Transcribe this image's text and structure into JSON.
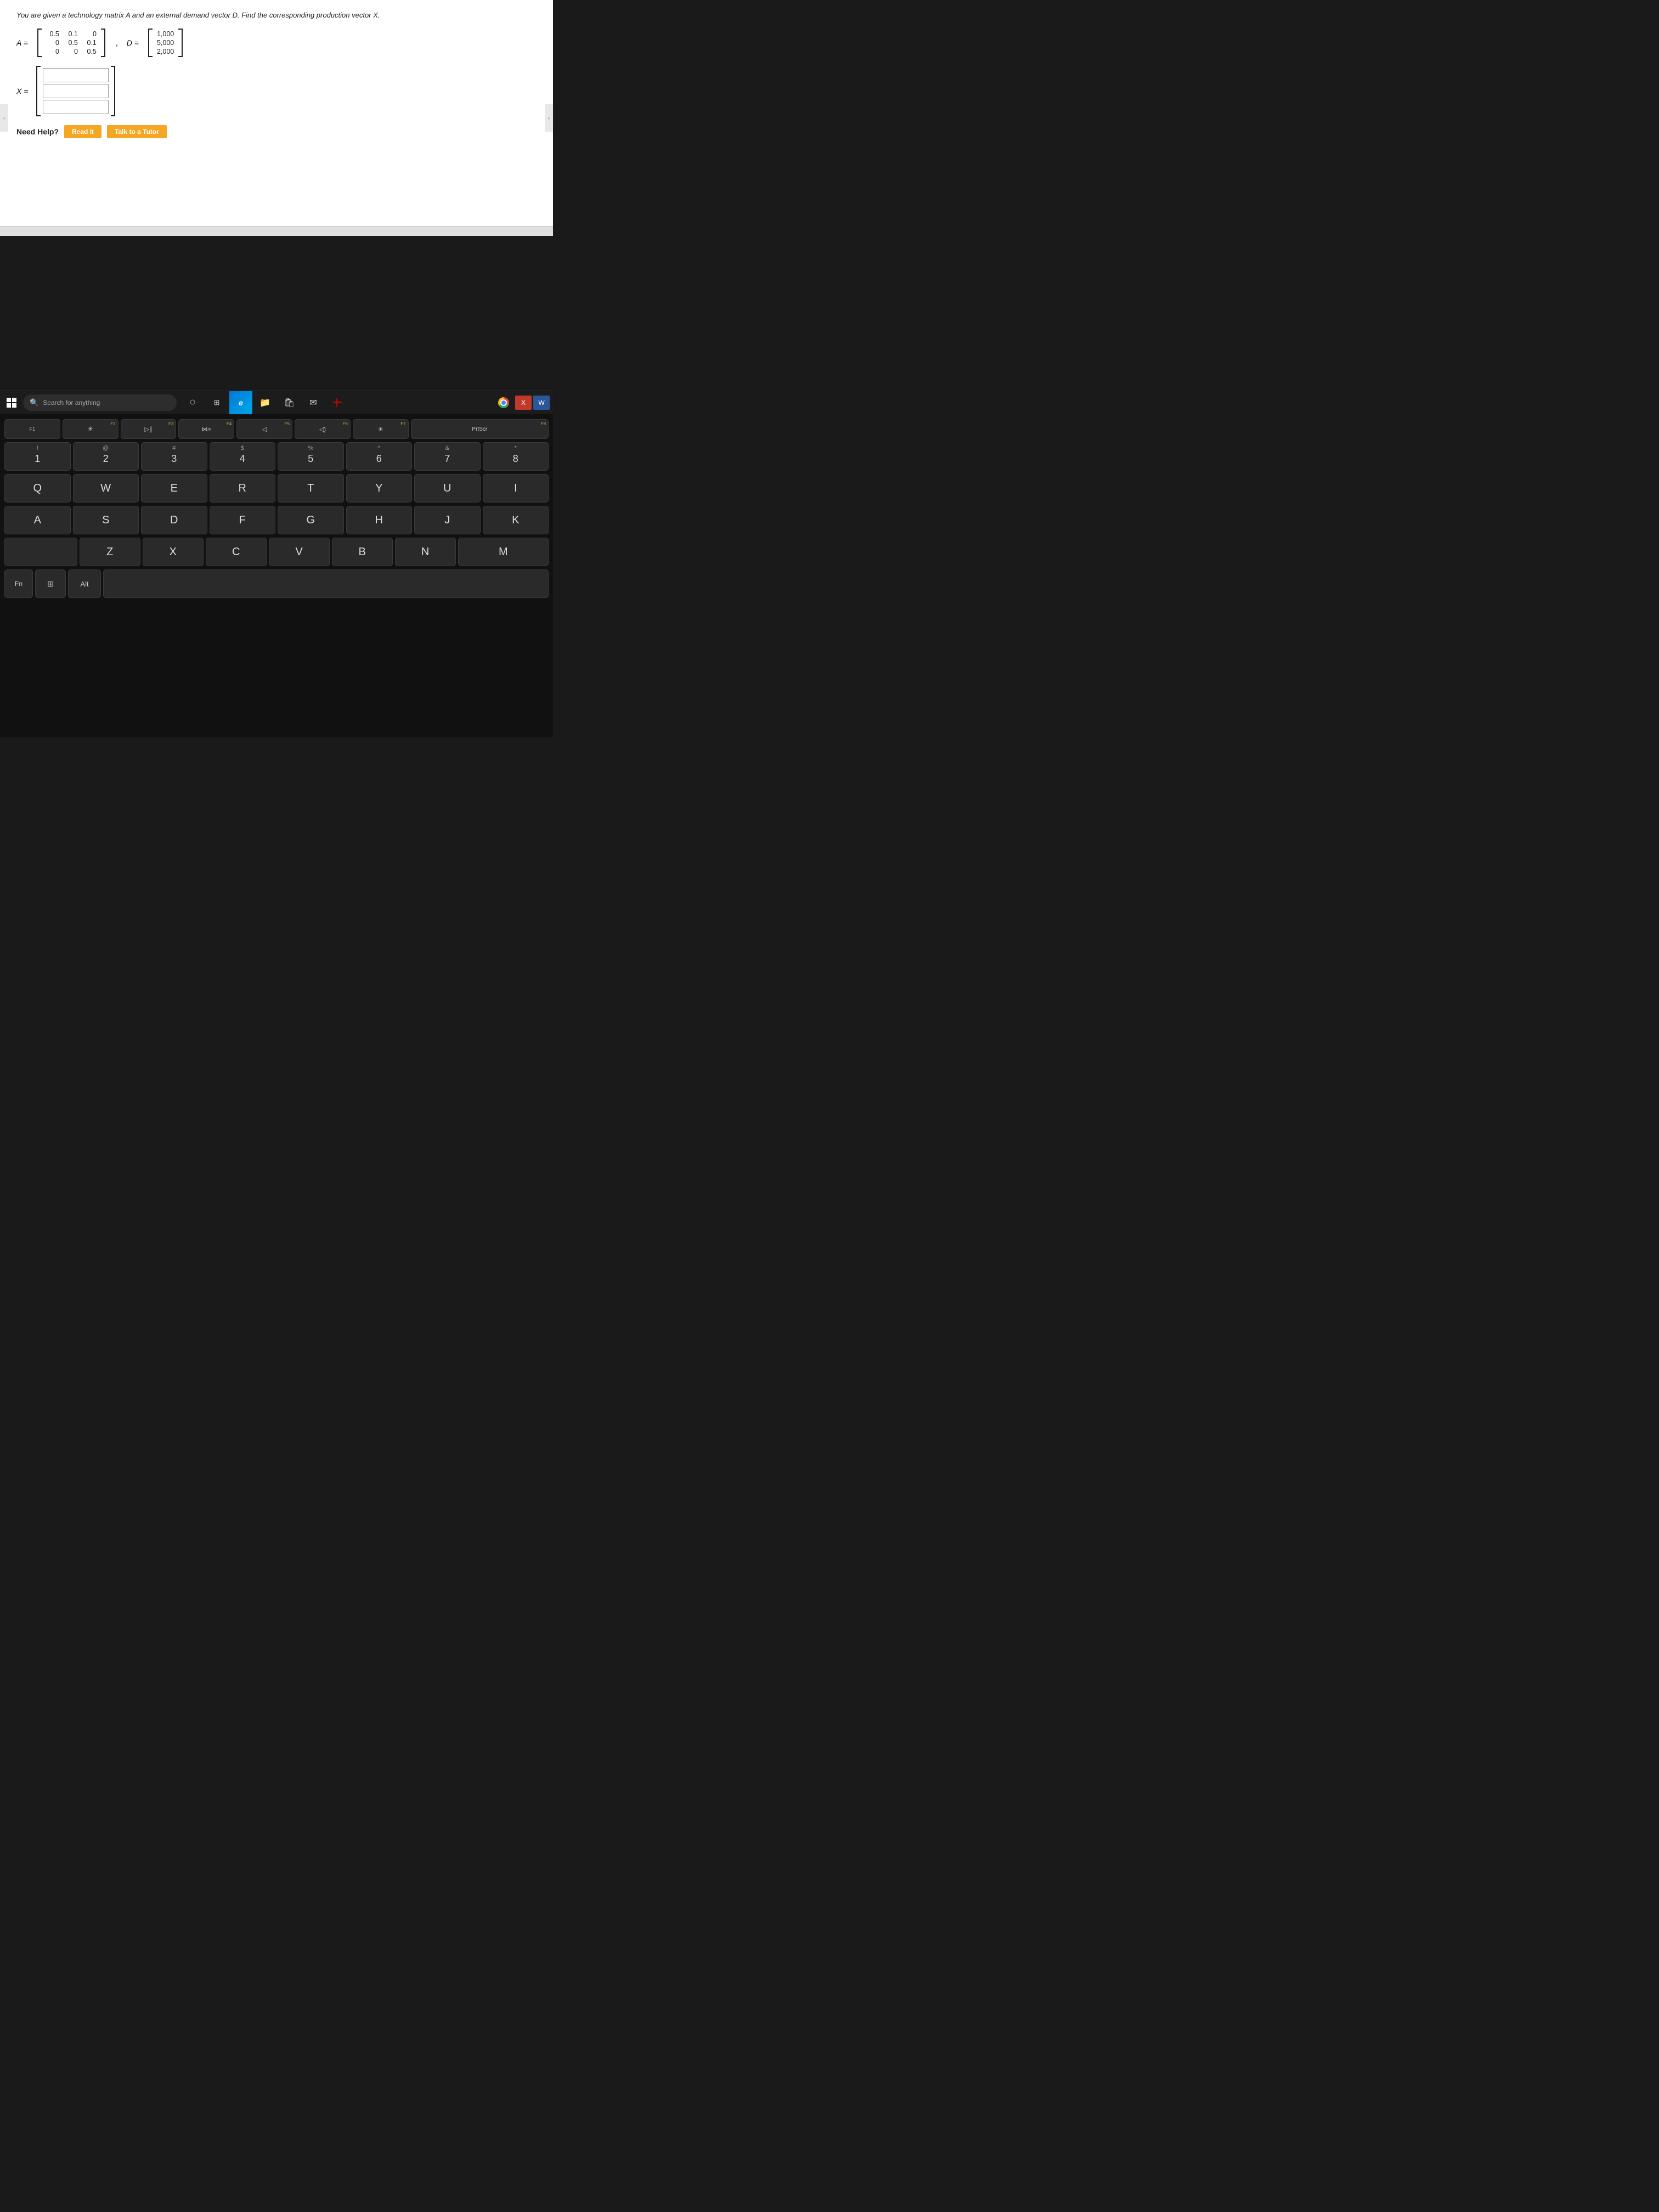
{
  "screen": {
    "problem_text": "You are given a technology matrix A and an external demand vector D. Find the corresponding production vector X.",
    "matrix_A_label": "A =",
    "matrix_A_rows": [
      [
        "0.5",
        "0.1",
        "0"
      ],
      [
        "0",
        "0.5",
        "0.1"
      ],
      [
        "0",
        "0",
        "0.5"
      ]
    ],
    "matrix_D_label": "D =",
    "matrix_D_rows": [
      [
        "1,000"
      ],
      [
        "5,000"
      ],
      [
        "2,000"
      ]
    ],
    "x_label": "X =",
    "x_inputs": [
      "",
      "",
      ""
    ],
    "need_help_label": "Need Help?",
    "btn_read_it": "Read It",
    "btn_talk_tutor": "Talk to a Tutor"
  },
  "taskbar": {
    "search_placeholder": "Search for anything",
    "start_label": "Start",
    "icons": [
      {
        "name": "cortana-circle",
        "symbol": "○"
      },
      {
        "name": "task-view",
        "symbol": "⊞"
      },
      {
        "name": "edge-browser",
        "symbol": "e"
      },
      {
        "name": "file-explorer",
        "symbol": "📁"
      },
      {
        "name": "store",
        "symbol": "🛍"
      },
      {
        "name": "mail",
        "symbol": "✉"
      },
      {
        "name": "snip-sketch",
        "symbol": "✂"
      },
      {
        "name": "chrome",
        "symbol": ""
      },
      {
        "name": "x-app",
        "symbol": "X"
      },
      {
        "name": "word-app",
        "symbol": "W"
      }
    ]
  },
  "keyboard": {
    "fn_row": [
      {
        "label": "",
        "sub": "F1"
      },
      {
        "label": "※",
        "sub": "F2"
      },
      {
        "label": "▷∥",
        "sub": "F3"
      },
      {
        "label": "◁×",
        "sub": "F4"
      },
      {
        "label": "◁",
        "sub": "F5"
      },
      {
        "label": "◁)",
        "sub": "F6"
      },
      {
        "label": "☀",
        "sub": "F7"
      },
      {
        "label": "PrtScr",
        "sub": "F8"
      }
    ],
    "num_row": [
      {
        "sym": "!",
        "main": "1"
      },
      {
        "sym": "@",
        "main": "2"
      },
      {
        "sym": "#",
        "main": "3"
      },
      {
        "sym": "$",
        "main": "4"
      },
      {
        "sym": "%",
        "main": "5"
      },
      {
        "sym": "^",
        "main": "6"
      },
      {
        "sym": "&",
        "main": "7"
      },
      {
        "sym": "*",
        "main": "8"
      }
    ],
    "qwerty_row": [
      "Q",
      "W",
      "E",
      "R",
      "T",
      "Y",
      "U",
      "I"
    ],
    "asdf_row": [
      "A",
      "S",
      "D",
      "F",
      "G",
      "H",
      "J",
      "K"
    ],
    "zxcv_row": [
      "Z",
      "X",
      "C",
      "V",
      "B",
      "N",
      "M"
    ],
    "bottom_special": [
      "Fn",
      "⊞",
      "Alt"
    ]
  }
}
